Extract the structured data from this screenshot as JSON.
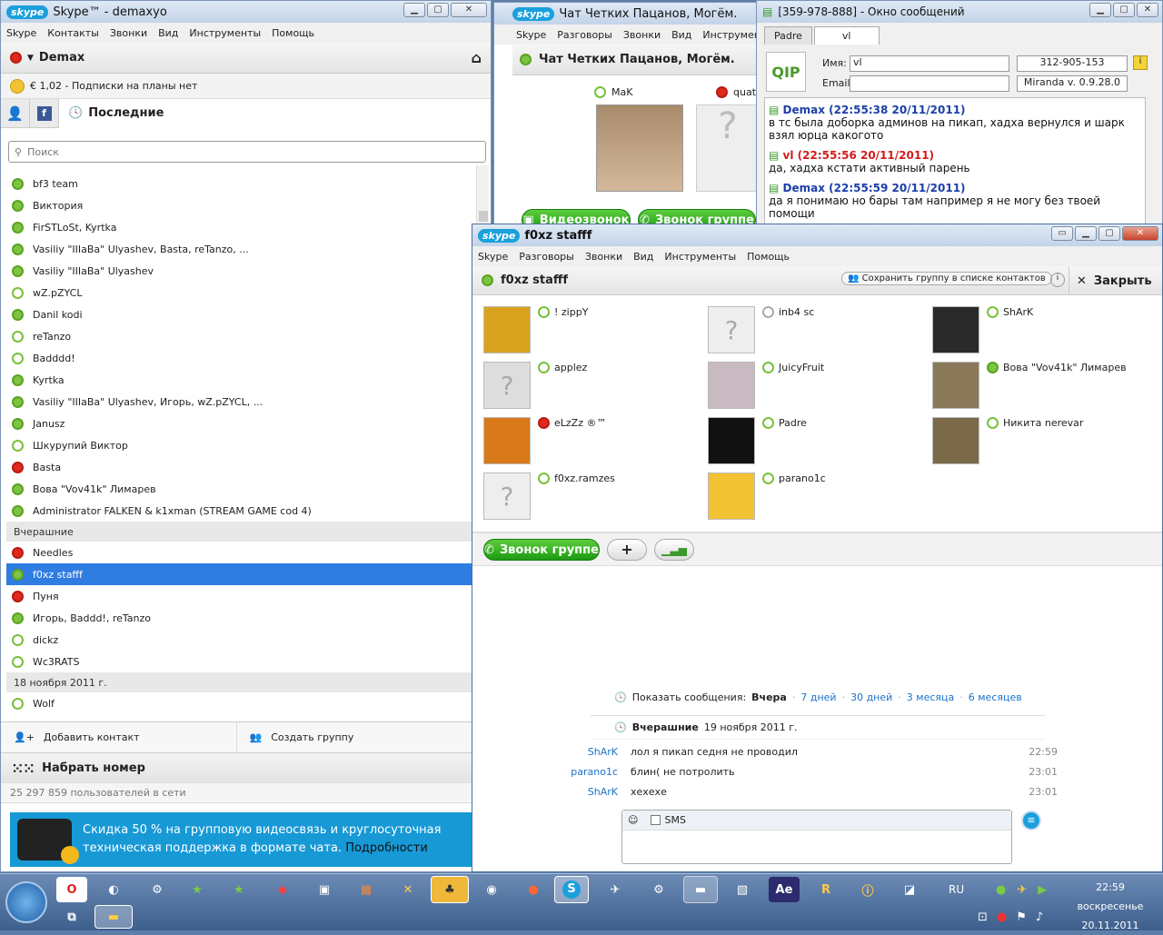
{
  "main_window": {
    "title": "Skype™ - demaxyo",
    "menu": [
      "Skype",
      "Контакты",
      "Звонки",
      "Вид",
      "Инструменты",
      "Помощь"
    ],
    "user": "Demax",
    "credit": "€ 1,02 - Подписки на планы нет",
    "tab_recent": "Последние",
    "search_placeholder": "Поиск",
    "contacts": [
      {
        "name": "bf3 team",
        "status": "on"
      },
      {
        "name": "Виктория",
        "status": "on"
      },
      {
        "name": "FirSTLoSt, Kyrtka",
        "status": "on"
      },
      {
        "name": "Vasiliy \"IIIaBa\" Ulyashev, Basta, reTanzo, ...",
        "status": "on"
      },
      {
        "name": "Vasiliy \"IIIaBa\" Ulyashev",
        "status": "on"
      },
      {
        "name": "wZ.pZYCL",
        "status": "off"
      },
      {
        "name": "Danil kodi",
        "status": "on"
      },
      {
        "name": "reTanzo",
        "status": "off"
      },
      {
        "name": "Badddd!",
        "status": "off"
      },
      {
        "name": "Kyrtka",
        "status": "on"
      },
      {
        "name": "Vasiliy \"IIIaBa\" Ulyashev, Игорь, wZ.pZYCL, ...",
        "status": "on"
      },
      {
        "name": "Janusz",
        "status": "on"
      },
      {
        "name": "Шкурупий Виктор",
        "status": "off"
      },
      {
        "name": "Basta",
        "status": "busy"
      },
      {
        "name": "Вова \"Vov41k\" Лимарев",
        "status": "on"
      },
      {
        "name": "Administrator FALKEN & k1xman (STREAM GAME cod 4)",
        "status": "on"
      }
    ],
    "group_yesterday": "Вчерашние",
    "contacts_yesterday": [
      {
        "name": "Needles",
        "status": "busy"
      },
      {
        "name": "f0xz stafff",
        "status": "on",
        "selected": true
      },
      {
        "name": "Пуня",
        "status": "busy"
      },
      {
        "name": "Игорь, Baddd!, reTanzo",
        "status": "on"
      },
      {
        "name": "dickz",
        "status": "off"
      },
      {
        "name": "Wc3RATS",
        "status": "off"
      }
    ],
    "group_date": "18 ноября 2011 г.",
    "contacts_date": [
      {
        "name": "Wolf",
        "status": "off"
      }
    ],
    "add_contact": "Добавить контакт",
    "create_group": "Создать группу",
    "dial": "Набрать номер",
    "online_count": "25 297 859 пользователей в сети",
    "promo_text": "Скидка 50 % на групповую видеосвязь и круглосуточная техническая поддержка в формате чата.",
    "promo_link": "Подробности"
  },
  "back_chat": {
    "title": "Чат Четких Пацанов, Могём.",
    "menu": [
      "Skype",
      "Разговоры",
      "Звонки",
      "Вид",
      "Инструменты"
    ],
    "header": "Чат Четких Пацанов, Могём.",
    "member1": "MaK",
    "member2": "quat",
    "video_call": "Видеозвонок",
    "group_call": "Звонок группе"
  },
  "miranda": {
    "title": "[359-978-888] - Окно сообщений",
    "tab1": "Padre",
    "tab2": "vl",
    "name_label": "Имя:",
    "name_value": "vl",
    "email_label": "Email:",
    "uin": "312-905-153",
    "client": "Miranda v. 0.9.28.0",
    "messages": [
      {
        "from": "Demax (22:55:38 20/11/2011)",
        "text": "в тс была доборка админов на пикап, хадха вернулся и шарк взял юрца какогото",
        "color": "blue"
      },
      {
        "from": "vl (22:55:56 20/11/2011)",
        "text": "да, хадха кстати активный парень",
        "color": "red"
      },
      {
        "from": "Demax (22:55:59 20/11/2011)",
        "text": "да я понимаю но бары там например я не могу без твоей помощи",
        "color": "blue"
      }
    ]
  },
  "group_chat": {
    "title": "f0xz stafff",
    "menu": [
      "Skype",
      "Разговоры",
      "Звонки",
      "Вид",
      "Инструменты",
      "Помощь"
    ],
    "header": "f0xz stafff",
    "save_group": "Сохранить группу в списке контактов",
    "close": "Закрыть",
    "members": [
      {
        "name": "! zippY",
        "status": "off"
      },
      {
        "name": "inb4 sc",
        "status": "unk"
      },
      {
        "name": "ShArK",
        "status": "off"
      },
      {
        "name": "applez",
        "status": "off"
      },
      {
        "name": "JuicyFruit",
        "status": "off"
      },
      {
        "name": "Вова \"Vov41k\" Лимарев",
        "status": "on"
      },
      {
        "name": "eLzZz ®™",
        "status": "busy"
      },
      {
        "name": "Padre",
        "status": "off"
      },
      {
        "name": "Никита nerevar",
        "status": "off"
      },
      {
        "name": "f0xz.ramzes",
        "status": "off"
      },
      {
        "name": "parano1c",
        "status": "off"
      }
    ],
    "group_call": "Звонок группе",
    "show_messages_label": "Показать сообщения:",
    "show_current": "Вчера",
    "show_options": [
      "7 дней",
      "30 дней",
      "3 месяца",
      "6 месяцев"
    ],
    "day_header_bold": "Вчерашние",
    "day_header_date": "19 ноября 2011 г.",
    "lines": [
      {
        "who": "ShArK",
        "text": "лол я пикап седня не проводил",
        "time": "22:59"
      },
      {
        "who": "parano1c",
        "text": "блин( не потролить",
        "time": "23:01"
      },
      {
        "who": "ShArK",
        "text": "хехехе",
        "time": "23:01"
      }
    ],
    "sms_label": "SMS"
  },
  "taskbar": {
    "lang": "RU",
    "time": "22:59",
    "day": "воскресенье",
    "date": "20.11.2011"
  }
}
